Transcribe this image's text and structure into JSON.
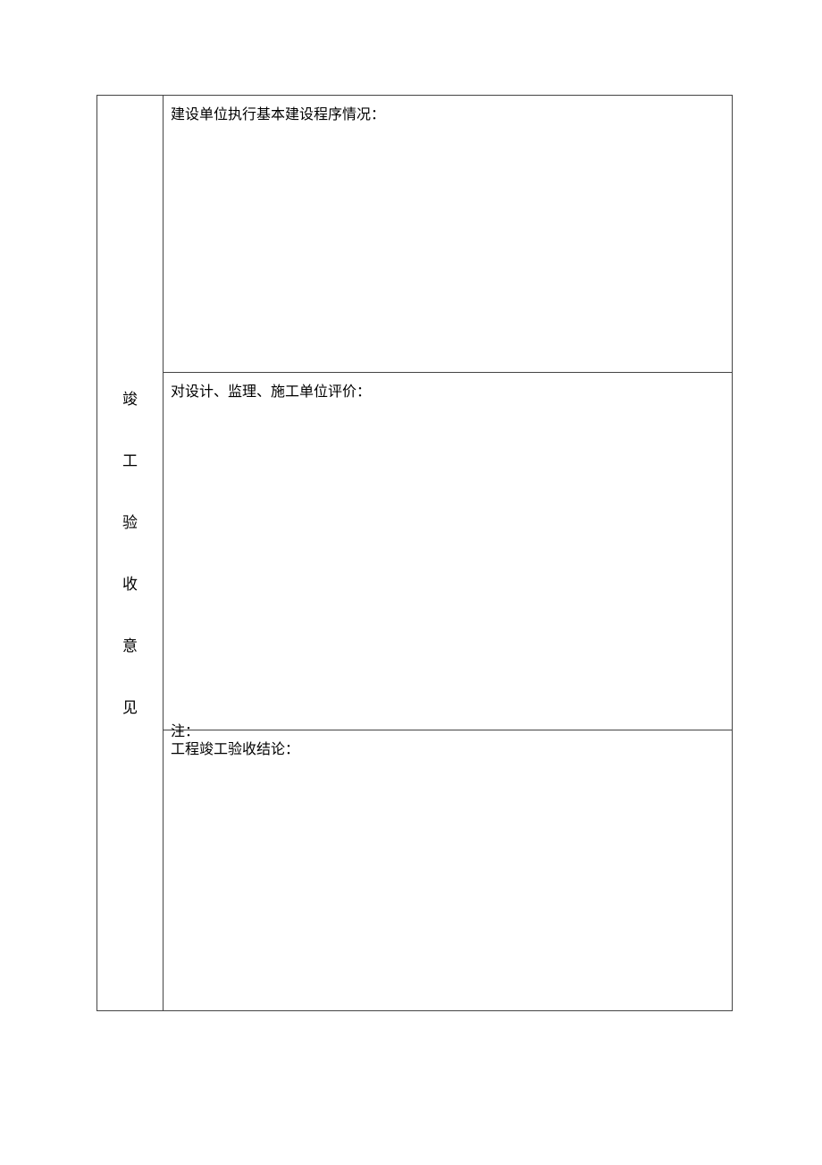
{
  "sidebar": {
    "title_chars": [
      "竣",
      "工",
      "验",
      "收",
      "意",
      "见"
    ]
  },
  "rows": {
    "r1_label": "建设单位执行基本建设程序情况：",
    "r2_label": "对设计、监理、施工单位评价：",
    "r3_label_top": "工程竣工验收结论：",
    "r3_label_bottom": "注："
  }
}
